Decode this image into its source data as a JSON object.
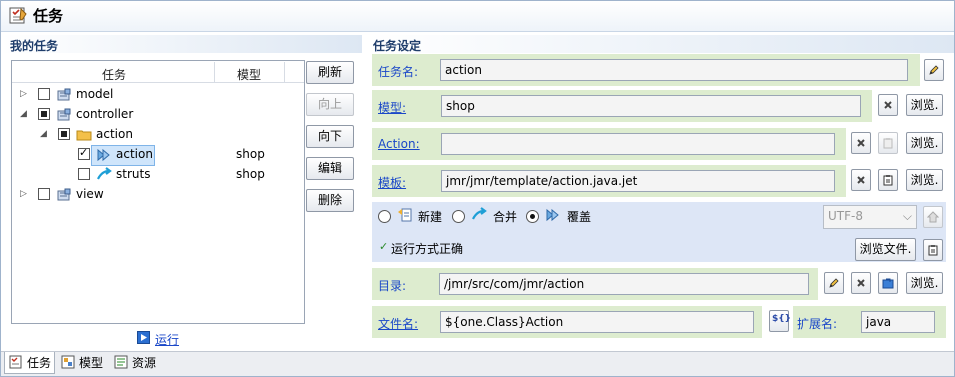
{
  "window": {
    "title": "任务"
  },
  "left": {
    "section_title": "我的任务",
    "columns": [
      "任务",
      "模型"
    ],
    "tree": [
      {
        "label": "model",
        "model": "",
        "check": "none",
        "expander": "closed",
        "icon": "model-folder-icon"
      },
      {
        "label": "controller",
        "model": "",
        "check": "partial",
        "expander": "open",
        "icon": "model-folder-icon"
      },
      {
        "label": "action",
        "model": "",
        "check": "partial",
        "expander": "open",
        "icon": "folder-icon"
      },
      {
        "label": "action",
        "model": "shop",
        "check": "checked",
        "expander": "none",
        "icon": "action-icon",
        "selected": true
      },
      {
        "label": "struts",
        "model": "shop",
        "check": "none",
        "expander": "none",
        "icon": "struts-icon"
      },
      {
        "label": "view",
        "model": "",
        "check": "none",
        "expander": "closed",
        "icon": "model-folder-icon"
      }
    ],
    "buttons": {
      "refresh": "刷新",
      "up": "向上",
      "down": "向下",
      "edit": "编辑",
      "delete": "删除"
    },
    "run_label": "运行"
  },
  "right": {
    "section_title": "任务设定",
    "task_name": {
      "label": "任务名:",
      "value": "action"
    },
    "model": {
      "label": "模型:",
      "value": "shop"
    },
    "action": {
      "label": "Action:",
      "value": ""
    },
    "template": {
      "label": "模板:",
      "value": "jmr/jmr/template/action.java.jet"
    },
    "browse": "浏览.",
    "browse_file": "浏览文件.",
    "mode_options": [
      "新建",
      "合并",
      "覆盖"
    ],
    "mode_selected": "覆盖",
    "encoding": "UTF-8",
    "status": "运行方式正确",
    "directory": {
      "label": "目录:",
      "value": "/jmr/src/com/jmr/action"
    },
    "filename": {
      "label": "文件名:",
      "value": "${one.Class}Action"
    },
    "extension": {
      "label": "扩展名:",
      "value": "java"
    },
    "var_button": "${}"
  },
  "tabs": [
    "任务",
    "模型",
    "资源"
  ],
  "colors": {
    "field_bg": "#ddeccf",
    "option_bg": "#dde6f6",
    "link": "#1a47c8",
    "section_text": "#1f3d6b"
  }
}
